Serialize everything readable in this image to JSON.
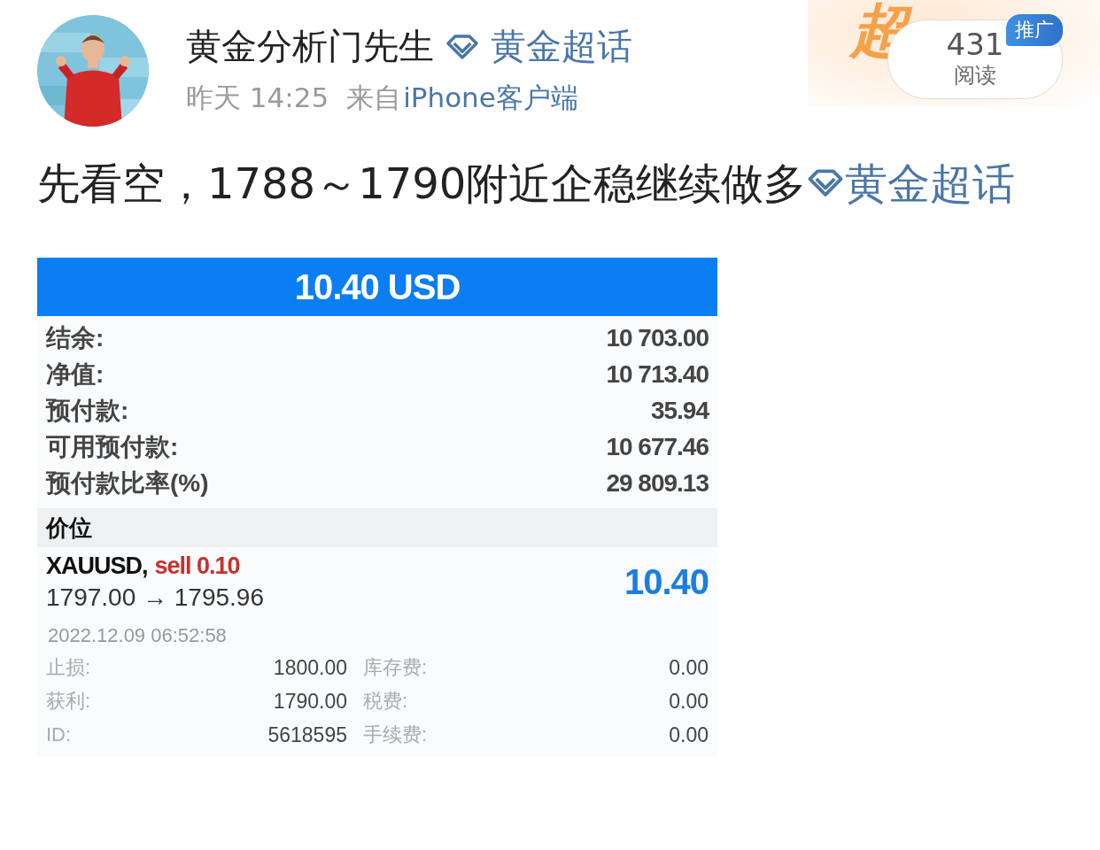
{
  "post": {
    "author": "黄金分析门先生",
    "topic": "黄金超话",
    "time": "昨天 14:25",
    "source_prefix": "来自",
    "source": "iPhone客户端",
    "banner_text": "超",
    "reads": {
      "count": "431",
      "label": "阅读",
      "badge": "推广"
    },
    "text": "先看空，1788～1790附近企稳继续做多",
    "text_topic": "黄金超话"
  },
  "trade_card": {
    "header": "10.40 USD",
    "summary": [
      {
        "label": "结余:",
        "value": "10 703.00"
      },
      {
        "label": "净值:",
        "value": "10 713.40"
      },
      {
        "label": "预付款:",
        "value": "35.94"
      },
      {
        "label": "可用预付款:",
        "value": "10 677.46"
      },
      {
        "label": "预付款比率(%)",
        "value": "29 809.13"
      }
    ],
    "section_title": "价位",
    "position": {
      "symbol": "XAUUSD,",
      "side": "sell 0.10",
      "prices": "1797.00 → 1795.96",
      "profit": "10.40",
      "time": "2022.12.09 06:52:58"
    },
    "details": [
      {
        "label": "止损:",
        "value": "1800.00",
        "label_2": "库存费:",
        "value_2": "0.00"
      },
      {
        "label": "获利:",
        "value": "1790.00",
        "label_2": "税费:",
        "value_2": "0.00"
      },
      {
        "label": "ID:",
        "value": "5618595",
        "label_2": "手续费:",
        "value_2": "0.00"
      }
    ]
  }
}
